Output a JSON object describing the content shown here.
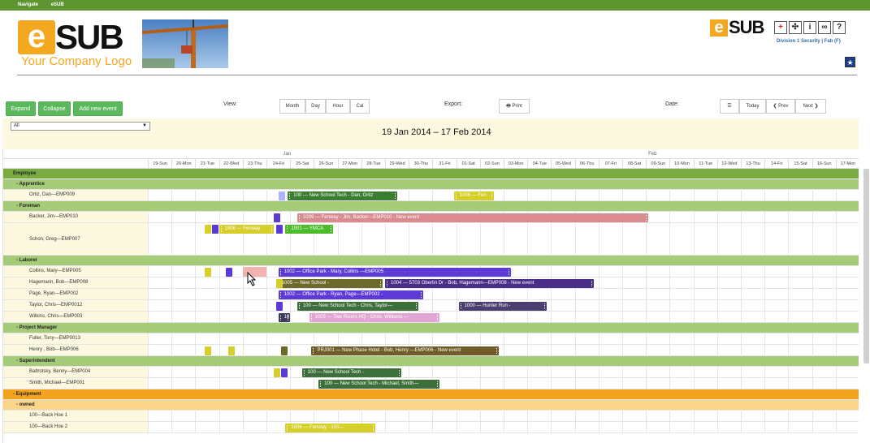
{
  "nav": {
    "item1": "Navigate",
    "item2": "eSUB"
  },
  "logo": {
    "e": "e",
    "sub": "SUB",
    "tagline": "Your Company Logo"
  },
  "brand": {
    "e": "e",
    "sub": "SUB"
  },
  "division": {
    "text": "Division 1 Security",
    "sep": "|",
    "user": "Fab (F)"
  },
  "buttons": {
    "expand": "Expand",
    "collapse": "Collapse",
    "add": "Add new event"
  },
  "view": {
    "label": "View:",
    "month": "Month",
    "day": "Day",
    "hour": "Hour",
    "cal": "Cal"
  },
  "export": {
    "label": "Export:",
    "print": "Print"
  },
  "date": {
    "label": "Date:",
    "today": "Today",
    "prev": "Prev",
    "next": "Next"
  },
  "filter": {
    "value": "All"
  },
  "range_title": "19 Jan 2014 – 17 Feb 2014",
  "months": [
    "Jan",
    "Feb"
  ],
  "days": [
    "19-Sun",
    "20-Mon",
    "21-Tue",
    "22-Wed",
    "23-Thu",
    "24-Fri",
    "25-Sat",
    "26-Sun",
    "27-Mon",
    "28-Tue",
    "29-Wed",
    "30-Thu",
    "31-Fri",
    "01-Sat",
    "02-Sun",
    "03-Mon",
    "04-Tue",
    "05-Wed",
    "06-Thu",
    "07-Fri",
    "08-Sat",
    "09-Sun",
    "10-Mon",
    "11-Tue",
    "12-Wed",
    "13-Thu",
    "14-Fri",
    "15-Sat",
    "16-Sun",
    "17-Mon"
  ],
  "rows": [
    {
      "type": "grp",
      "name": "Employee",
      "color": "#7aab43"
    },
    {
      "type": "sub",
      "name": "- Apprentice",
      "color": "#a6cc7a"
    },
    {
      "type": "emp",
      "name": "Ortiz, Dan—EMP009"
    },
    {
      "type": "sub",
      "name": "- Foreman",
      "color": "#a6cc7a"
    },
    {
      "type": "emp",
      "name": "Backer, Jim—EMP010"
    },
    {
      "type": "emp2",
      "name": "Schon, Greg—EMP007"
    },
    {
      "type": "sub",
      "name": "- Laborer",
      "color": "#a6cc7a"
    },
    {
      "type": "emp",
      "name": "Collins, Mary—EMP005"
    },
    {
      "type": "emp",
      "name": "Hagemann, Bob—EMP008"
    },
    {
      "type": "emp",
      "name": "Page, Ryan—EMP002"
    },
    {
      "type": "emp",
      "name": "Taylor, Chris—EMP0012"
    },
    {
      "type": "emp",
      "name": "Wilkins, Chris—EMP003"
    },
    {
      "type": "sub",
      "name": "- Project Manager",
      "color": "#a6cc7a"
    },
    {
      "type": "emp",
      "name": "Fuller, Tony—EMP0013"
    },
    {
      "type": "emp",
      "name": "Henry , Bob—EMP006"
    },
    {
      "type": "sub",
      "name": "- Superintendent",
      "color": "#a6cc7a"
    },
    {
      "type": "emp",
      "name": "Baltrotsky, Benny—EMP004"
    },
    {
      "type": "emp",
      "name": "Smith, Michael—EMP001"
    },
    {
      "type": "grp",
      "name": "- Equipment",
      "color": "#f3a41f"
    },
    {
      "type": "sub",
      "name": "- owned",
      "color": "#fbd58a"
    },
    {
      "type": "emp",
      "name": "100—Back Hoe 1"
    },
    {
      "type": "emp",
      "name": "100—Back Hoe 2"
    }
  ],
  "events": [
    {
      "row": 2,
      "start": 5.9,
      "end": 10.5,
      "label": "100 — New School Tech - Dan, Ortiz",
      "color": "#3a7d2e"
    },
    {
      "row": 2,
      "start": 12.9,
      "end": 14.6,
      "label": "1006 — Fen",
      "color": "#d6cf2a"
    },
    {
      "row": 4,
      "start": 6.3,
      "end": 21.1,
      "label": "1009 — Fenway - Jim, Backer—EMP010 - New event",
      "color": "#d98b8f"
    },
    {
      "row": 5,
      "start": 3.0,
      "end": 5.3,
      "label": "1006 — Fenway",
      "color": "#d6cf2a"
    },
    {
      "row": 5,
      "start": 5.8,
      "end": 7.8,
      "label": "1001 — YMCA",
      "color": "#4cbb2c"
    },
    {
      "row": 7,
      "start": 5.5,
      "end": 15.3,
      "label": "1002 — Office Park - Mary, Collins —EMP005",
      "color": "#5b3ad6"
    },
    {
      "row": 8,
      "start": 5.4,
      "end": 9.9,
      "label": "1005 — New School -",
      "color": "#6c6a2a"
    },
    {
      "row": 8,
      "start": 10.0,
      "end": 18.8,
      "label": "1004 — 5703 Oberlin Dr - Bob, Hagemann—EMP008 - New event",
      "color": "#4a2d86"
    },
    {
      "row": 9,
      "start": 5.5,
      "end": 11.6,
      "label": "1002 — Office Park - Ryan, Page—EMP002 -",
      "color": "#5b3ad6"
    },
    {
      "row": 10,
      "start": 6.3,
      "end": 11.4,
      "label": "100 — New School Tech - Chris, Taylor—",
      "color": "#3d6f3a"
    },
    {
      "row": 10,
      "start": 13.1,
      "end": 16.8,
      "label": "1000 — Hunter Run -",
      "color": "#4c3f6f"
    },
    {
      "row": 11,
      "start": 5.5,
      "end": 6.0,
      "label": "10",
      "color": "#3a3a5a"
    },
    {
      "row": 11,
      "start": 6.8,
      "end": 12.3,
      "label": "1003 — Two Rivers HQ - Chris, Williams —",
      "color": "#e2a6d4"
    },
    {
      "row": 14,
      "start": 6.9,
      "end": 14.8,
      "label": "PRJ001 — New Phase Hotel - Bob, Henry —EMP006 - New event",
      "color": "#6f5c27"
    },
    {
      "row": 16,
      "start": 6.5,
      "end": 10.7,
      "label": "100 — New School Tech -",
      "color": "#3d6f3a"
    },
    {
      "row": 17,
      "start": 7.2,
      "end": 12.3,
      "label": "100 — New School Tech - Michael, Smith—",
      "color": "#3d6f3a"
    },
    {
      "row": 21,
      "start": 5.8,
      "end": 9.6,
      "label": "1006 — Fenway - 100—",
      "color": "#d6cf2a"
    }
  ],
  "minis": [
    {
      "row": 2,
      "day": 5.5,
      "color": "#aab4ff"
    },
    {
      "row": 4,
      "day": 5.3,
      "color": "#5b3ad6"
    },
    {
      "row": 5,
      "day": 2.4,
      "color": "#d6cf2a"
    },
    {
      "row": 5,
      "day": 2.7,
      "color": "#5b3ad6"
    },
    {
      "row": 5,
      "day": 5.4,
      "color": "#5b3ad6"
    },
    {
      "row": 7,
      "day": 2.4,
      "color": "#d6cf2a"
    },
    {
      "row": 7,
      "day": 3.3,
      "color": "#5b3ad6"
    },
    {
      "row": 8,
      "day": 5.4,
      "color": "#d6cf2a"
    },
    {
      "row": 10,
      "day": 5.4,
      "color": "#5b3ad6"
    },
    {
      "row": 14,
      "day": 2.4,
      "color": "#d6cf2a"
    },
    {
      "row": 14,
      "day": 3.4,
      "color": "#d6cf2a"
    },
    {
      "row": 14,
      "day": 5.6,
      "color": "#6c6a2a"
    },
    {
      "row": 16,
      "day": 5.3,
      "color": "#d6cf2a"
    },
    {
      "row": 16,
      "day": 5.6,
      "color": "#5b3ad6"
    }
  ],
  "highlight": {
    "row": 7,
    "start": 4.0,
    "end": 5.0,
    "color": "#f2b3b0"
  }
}
